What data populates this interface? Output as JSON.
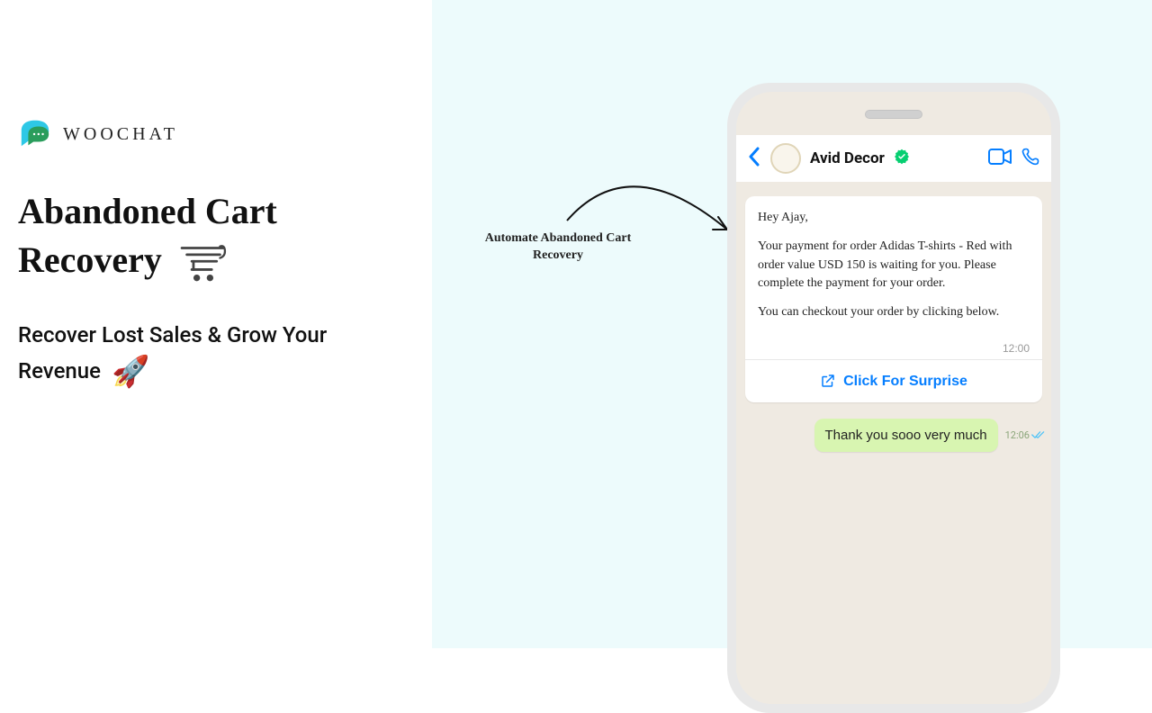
{
  "brand": {
    "name": "WOOCHAT"
  },
  "heading": {
    "line1": "Abandoned Cart",
    "line2": "Recovery"
  },
  "subtitle": "Recover Lost Sales & Grow Your Revenue",
  "arrow_label": "Automate Abandoned Cart Recovery",
  "chat": {
    "contact": "Avid Decor",
    "message": {
      "salutation": "Hey Ajay,",
      "body1": "Your payment for order Adidas T-shirts - Red with order value USD 150 is waiting for you. Please complete the payment for your order.",
      "body2": "You can checkout your order by clicking below.",
      "time": "12:00",
      "action": "Click For Surprise"
    },
    "reply": {
      "text": "Thank you sooo very much",
      "time": "12:06"
    }
  }
}
